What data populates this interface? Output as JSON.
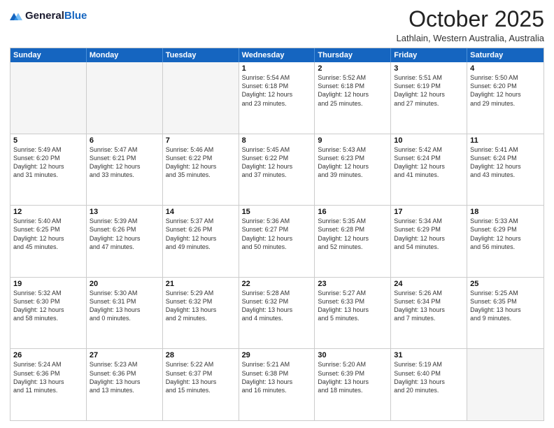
{
  "header": {
    "logo_line1": "General",
    "logo_line2": "Blue",
    "month": "October 2025",
    "location": "Lathlain, Western Australia, Australia"
  },
  "days_of_week": [
    "Sunday",
    "Monday",
    "Tuesday",
    "Wednesday",
    "Thursday",
    "Friday",
    "Saturday"
  ],
  "rows": [
    [
      {
        "day": "",
        "info": "",
        "empty": true
      },
      {
        "day": "",
        "info": "",
        "empty": true
      },
      {
        "day": "",
        "info": "",
        "empty": true
      },
      {
        "day": "1",
        "info": "Sunrise: 5:54 AM\nSunset: 6:18 PM\nDaylight: 12 hours\nand 23 minutes.",
        "empty": false
      },
      {
        "day": "2",
        "info": "Sunrise: 5:52 AM\nSunset: 6:18 PM\nDaylight: 12 hours\nand 25 minutes.",
        "empty": false
      },
      {
        "day": "3",
        "info": "Sunrise: 5:51 AM\nSunset: 6:19 PM\nDaylight: 12 hours\nand 27 minutes.",
        "empty": false
      },
      {
        "day": "4",
        "info": "Sunrise: 5:50 AM\nSunset: 6:20 PM\nDaylight: 12 hours\nand 29 minutes.",
        "empty": false
      }
    ],
    [
      {
        "day": "5",
        "info": "Sunrise: 5:49 AM\nSunset: 6:20 PM\nDaylight: 12 hours\nand 31 minutes.",
        "empty": false
      },
      {
        "day": "6",
        "info": "Sunrise: 5:47 AM\nSunset: 6:21 PM\nDaylight: 12 hours\nand 33 minutes.",
        "empty": false
      },
      {
        "day": "7",
        "info": "Sunrise: 5:46 AM\nSunset: 6:22 PM\nDaylight: 12 hours\nand 35 minutes.",
        "empty": false
      },
      {
        "day": "8",
        "info": "Sunrise: 5:45 AM\nSunset: 6:22 PM\nDaylight: 12 hours\nand 37 minutes.",
        "empty": false
      },
      {
        "day": "9",
        "info": "Sunrise: 5:43 AM\nSunset: 6:23 PM\nDaylight: 12 hours\nand 39 minutes.",
        "empty": false
      },
      {
        "day": "10",
        "info": "Sunrise: 5:42 AM\nSunset: 6:24 PM\nDaylight: 12 hours\nand 41 minutes.",
        "empty": false
      },
      {
        "day": "11",
        "info": "Sunrise: 5:41 AM\nSunset: 6:24 PM\nDaylight: 12 hours\nand 43 minutes.",
        "empty": false
      }
    ],
    [
      {
        "day": "12",
        "info": "Sunrise: 5:40 AM\nSunset: 6:25 PM\nDaylight: 12 hours\nand 45 minutes.",
        "empty": false
      },
      {
        "day": "13",
        "info": "Sunrise: 5:39 AM\nSunset: 6:26 PM\nDaylight: 12 hours\nand 47 minutes.",
        "empty": false
      },
      {
        "day": "14",
        "info": "Sunrise: 5:37 AM\nSunset: 6:26 PM\nDaylight: 12 hours\nand 49 minutes.",
        "empty": false
      },
      {
        "day": "15",
        "info": "Sunrise: 5:36 AM\nSunset: 6:27 PM\nDaylight: 12 hours\nand 50 minutes.",
        "empty": false
      },
      {
        "day": "16",
        "info": "Sunrise: 5:35 AM\nSunset: 6:28 PM\nDaylight: 12 hours\nand 52 minutes.",
        "empty": false
      },
      {
        "day": "17",
        "info": "Sunrise: 5:34 AM\nSunset: 6:29 PM\nDaylight: 12 hours\nand 54 minutes.",
        "empty": false
      },
      {
        "day": "18",
        "info": "Sunrise: 5:33 AM\nSunset: 6:29 PM\nDaylight: 12 hours\nand 56 minutes.",
        "empty": false
      }
    ],
    [
      {
        "day": "19",
        "info": "Sunrise: 5:32 AM\nSunset: 6:30 PM\nDaylight: 12 hours\nand 58 minutes.",
        "empty": false
      },
      {
        "day": "20",
        "info": "Sunrise: 5:30 AM\nSunset: 6:31 PM\nDaylight: 13 hours\nand 0 minutes.",
        "empty": false
      },
      {
        "day": "21",
        "info": "Sunrise: 5:29 AM\nSunset: 6:32 PM\nDaylight: 13 hours\nand 2 minutes.",
        "empty": false
      },
      {
        "day": "22",
        "info": "Sunrise: 5:28 AM\nSunset: 6:32 PM\nDaylight: 13 hours\nand 4 minutes.",
        "empty": false
      },
      {
        "day": "23",
        "info": "Sunrise: 5:27 AM\nSunset: 6:33 PM\nDaylight: 13 hours\nand 5 minutes.",
        "empty": false
      },
      {
        "day": "24",
        "info": "Sunrise: 5:26 AM\nSunset: 6:34 PM\nDaylight: 13 hours\nand 7 minutes.",
        "empty": false
      },
      {
        "day": "25",
        "info": "Sunrise: 5:25 AM\nSunset: 6:35 PM\nDaylight: 13 hours\nand 9 minutes.",
        "empty": false
      }
    ],
    [
      {
        "day": "26",
        "info": "Sunrise: 5:24 AM\nSunset: 6:36 PM\nDaylight: 13 hours\nand 11 minutes.",
        "empty": false
      },
      {
        "day": "27",
        "info": "Sunrise: 5:23 AM\nSunset: 6:36 PM\nDaylight: 13 hours\nand 13 minutes.",
        "empty": false
      },
      {
        "day": "28",
        "info": "Sunrise: 5:22 AM\nSunset: 6:37 PM\nDaylight: 13 hours\nand 15 minutes.",
        "empty": false
      },
      {
        "day": "29",
        "info": "Sunrise: 5:21 AM\nSunset: 6:38 PM\nDaylight: 13 hours\nand 16 minutes.",
        "empty": false
      },
      {
        "day": "30",
        "info": "Sunrise: 5:20 AM\nSunset: 6:39 PM\nDaylight: 13 hours\nand 18 minutes.",
        "empty": false
      },
      {
        "day": "31",
        "info": "Sunrise: 5:19 AM\nSunset: 6:40 PM\nDaylight: 13 hours\nand 20 minutes.",
        "empty": false
      },
      {
        "day": "",
        "info": "",
        "empty": true
      }
    ]
  ]
}
